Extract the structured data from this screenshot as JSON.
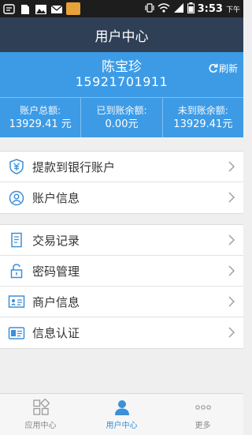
{
  "status_bar": {
    "time": "3:53",
    "ampm": "下午",
    "icons": [
      "notification-icon",
      "sim-icon",
      "image-icon",
      "mail-icon",
      "app-icon",
      "vibrate-icon",
      "wifi-icon",
      "signal-icon",
      "battery-icon"
    ]
  },
  "header": {
    "title": "用户中心"
  },
  "profile": {
    "name": "陈宝珍",
    "phone": "15921701911",
    "refresh_label": "刷新",
    "balances": [
      {
        "label": "账户总额:",
        "value": "13929.41 元"
      },
      {
        "label": "已到账余额:",
        "value": "0.00元"
      },
      {
        "label": "未到账余额:",
        "value": "13929.41元"
      }
    ]
  },
  "menu_group_1": [
    {
      "label": "提款到银行账户",
      "icon": "yuan-shield-icon"
    },
    {
      "label": "账户信息",
      "icon": "user-icon"
    }
  ],
  "menu_group_2": [
    {
      "label": "交易记录",
      "icon": "document-icon"
    },
    {
      "label": "密码管理",
      "icon": "lock-icon"
    },
    {
      "label": "商户信息",
      "icon": "merchant-card-icon"
    },
    {
      "label": "信息认证",
      "icon": "id-card-icon"
    }
  ],
  "tabs": [
    {
      "label": "应用中心",
      "icon": "grid-icon"
    },
    {
      "label": "用户中心",
      "icon": "person-icon"
    },
    {
      "label": "更多",
      "icon": "more-dots-icon"
    }
  ],
  "colors": {
    "header_bg": "#2f3f56",
    "profile_bg": "#3d9be6",
    "icon_blue": "#3d8fd8",
    "active_tab": "#3d8fd8"
  }
}
